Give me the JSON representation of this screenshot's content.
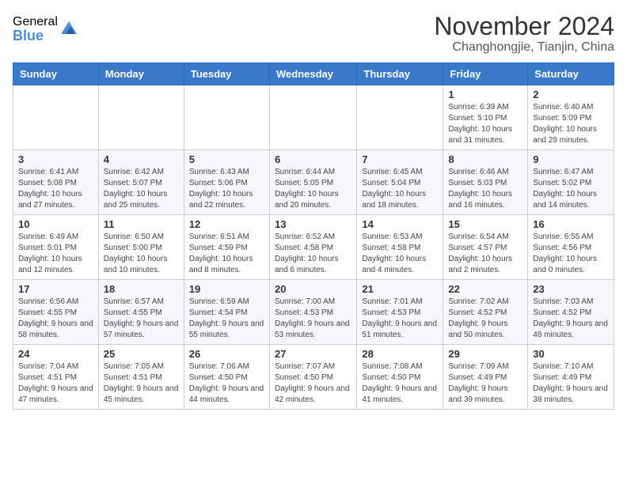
{
  "header": {
    "logo": {
      "general": "General",
      "blue": "Blue",
      "icon_title": "GeneralBlue logo"
    },
    "title": "November 2024",
    "location": "Changhongjie, Tianjin, China"
  },
  "weekdays": [
    "Sunday",
    "Monday",
    "Tuesday",
    "Wednesday",
    "Thursday",
    "Friday",
    "Saturday"
  ],
  "weeks": [
    [
      {
        "day": "",
        "info": ""
      },
      {
        "day": "",
        "info": ""
      },
      {
        "day": "",
        "info": ""
      },
      {
        "day": "",
        "info": ""
      },
      {
        "day": "",
        "info": ""
      },
      {
        "day": "1",
        "info": "Sunrise: 6:39 AM\nSunset: 5:10 PM\nDaylight: 10 hours and 31 minutes."
      },
      {
        "day": "2",
        "info": "Sunrise: 6:40 AM\nSunset: 5:09 PM\nDaylight: 10 hours and 29 minutes."
      }
    ],
    [
      {
        "day": "3",
        "info": "Sunrise: 6:41 AM\nSunset: 5:08 PM\nDaylight: 10 hours and 27 minutes."
      },
      {
        "day": "4",
        "info": "Sunrise: 6:42 AM\nSunset: 5:07 PM\nDaylight: 10 hours and 25 minutes."
      },
      {
        "day": "5",
        "info": "Sunrise: 6:43 AM\nSunset: 5:06 PM\nDaylight: 10 hours and 22 minutes."
      },
      {
        "day": "6",
        "info": "Sunrise: 6:44 AM\nSunset: 5:05 PM\nDaylight: 10 hours and 20 minutes."
      },
      {
        "day": "7",
        "info": "Sunrise: 6:45 AM\nSunset: 5:04 PM\nDaylight: 10 hours and 18 minutes."
      },
      {
        "day": "8",
        "info": "Sunrise: 6:46 AM\nSunset: 5:03 PM\nDaylight: 10 hours and 16 minutes."
      },
      {
        "day": "9",
        "info": "Sunrise: 6:47 AM\nSunset: 5:02 PM\nDaylight: 10 hours and 14 minutes."
      }
    ],
    [
      {
        "day": "10",
        "info": "Sunrise: 6:49 AM\nSunset: 5:01 PM\nDaylight: 10 hours and 12 minutes."
      },
      {
        "day": "11",
        "info": "Sunrise: 6:50 AM\nSunset: 5:00 PM\nDaylight: 10 hours and 10 minutes."
      },
      {
        "day": "12",
        "info": "Sunrise: 6:51 AM\nSunset: 4:59 PM\nDaylight: 10 hours and 8 minutes."
      },
      {
        "day": "13",
        "info": "Sunrise: 6:52 AM\nSunset: 4:58 PM\nDaylight: 10 hours and 6 minutes."
      },
      {
        "day": "14",
        "info": "Sunrise: 6:53 AM\nSunset: 4:58 PM\nDaylight: 10 hours and 4 minutes."
      },
      {
        "day": "15",
        "info": "Sunrise: 6:54 AM\nSunset: 4:57 PM\nDaylight: 10 hours and 2 minutes."
      },
      {
        "day": "16",
        "info": "Sunrise: 6:55 AM\nSunset: 4:56 PM\nDaylight: 10 hours and 0 minutes."
      }
    ],
    [
      {
        "day": "17",
        "info": "Sunrise: 6:56 AM\nSunset: 4:55 PM\nDaylight: 9 hours and 58 minutes."
      },
      {
        "day": "18",
        "info": "Sunrise: 6:57 AM\nSunset: 4:55 PM\nDaylight: 9 hours and 57 minutes."
      },
      {
        "day": "19",
        "info": "Sunrise: 6:59 AM\nSunset: 4:54 PM\nDaylight: 9 hours and 55 minutes."
      },
      {
        "day": "20",
        "info": "Sunrise: 7:00 AM\nSunset: 4:53 PM\nDaylight: 9 hours and 53 minutes."
      },
      {
        "day": "21",
        "info": "Sunrise: 7:01 AM\nSunset: 4:53 PM\nDaylight: 9 hours and 51 minutes."
      },
      {
        "day": "22",
        "info": "Sunrise: 7:02 AM\nSunset: 4:52 PM\nDaylight: 9 hours and 50 minutes."
      },
      {
        "day": "23",
        "info": "Sunrise: 7:03 AM\nSunset: 4:52 PM\nDaylight: 9 hours and 48 minutes."
      }
    ],
    [
      {
        "day": "24",
        "info": "Sunrise: 7:04 AM\nSunset: 4:51 PM\nDaylight: 9 hours and 47 minutes."
      },
      {
        "day": "25",
        "info": "Sunrise: 7:05 AM\nSunset: 4:51 PM\nDaylight: 9 hours and 45 minutes."
      },
      {
        "day": "26",
        "info": "Sunrise: 7:06 AM\nSunset: 4:50 PM\nDaylight: 9 hours and 44 minutes."
      },
      {
        "day": "27",
        "info": "Sunrise: 7:07 AM\nSunset: 4:50 PM\nDaylight: 9 hours and 42 minutes."
      },
      {
        "day": "28",
        "info": "Sunrise: 7:08 AM\nSunset: 4:50 PM\nDaylight: 9 hours and 41 minutes."
      },
      {
        "day": "29",
        "info": "Sunrise: 7:09 AM\nSunset: 4:49 PM\nDaylight: 9 hours and 39 minutes."
      },
      {
        "day": "30",
        "info": "Sunrise: 7:10 AM\nSunset: 4:49 PM\nDaylight: 9 hours and 38 minutes."
      }
    ]
  ]
}
